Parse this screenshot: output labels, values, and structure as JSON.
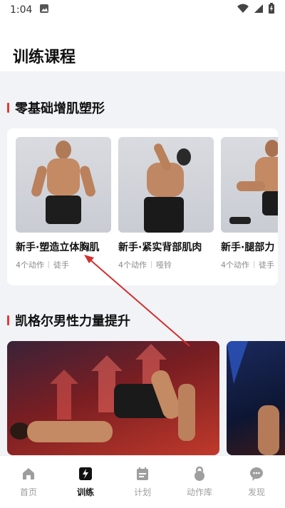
{
  "status": {
    "time": "1:04"
  },
  "page": {
    "title": "训练课程"
  },
  "section1": {
    "title": "零基础增肌塑形",
    "courses": [
      {
        "name": "新手·塑造立体胸肌",
        "count": "4个动作",
        "equipment": "徒手"
      },
      {
        "name": "新手·紧实背部肌肉",
        "count": "4个动作",
        "equipment": "哑铃"
      },
      {
        "name": "新手·腿部力",
        "count": "4个动作",
        "equipment": "徒手"
      }
    ]
  },
  "section2": {
    "title": "凯格尔男性力量提升"
  },
  "tabs": [
    {
      "label": "首页",
      "icon": "home-icon",
      "active": false
    },
    {
      "label": "训练",
      "icon": "lightning-icon",
      "active": true
    },
    {
      "label": "计划",
      "icon": "calendar-icon",
      "active": false
    },
    {
      "label": "动作库",
      "icon": "kettlebell-icon",
      "active": false
    },
    {
      "label": "发现",
      "icon": "chat-icon",
      "active": false
    }
  ],
  "colors": {
    "accent": "#e53935",
    "background": "#f2f3f7",
    "annotation_arrow": "#d32f2f"
  }
}
